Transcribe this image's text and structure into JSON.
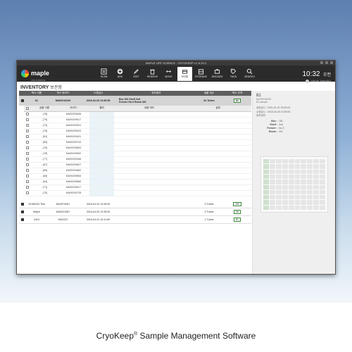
{
  "window": {
    "title": "MAPLE LIFE SCIENCE - CRYOKEEP v.1.6.20.2"
  },
  "brand": {
    "name": "maple",
    "tagline": "LIFE SCIENCE"
  },
  "toolbar": [
    {
      "label": "SCAN",
      "icon": "scan-icon"
    },
    {
      "label": "ADD",
      "icon": "add-icon"
    },
    {
      "label": "EDIT",
      "icon": "edit-icon"
    },
    {
      "label": "REMOVE",
      "icon": "remove-icon"
    },
    {
      "label": "MOVE",
      "icon": "move-icon"
    },
    {
      "label": "보관함",
      "icon": "storage-box-icon",
      "active": true
    },
    {
      "label": "STORAGE",
      "icon": "storage-icon"
    },
    {
      "label": "DISCARD",
      "icon": "discard-icon"
    },
    {
      "label": "TAGS",
      "icon": "tag-icon"
    },
    {
      "label": "SEARCH",
      "icon": "search-icon"
    }
  ],
  "clock": {
    "time": "10:32",
    "ampm": "오전",
    "user": "admin (Maple)"
  },
  "page": {
    "title": "INVENTORY",
    "subtitle": "보관함"
  },
  "top_table": {
    "headers": [
      "",
      "박스 이름",
      "박스 바코드",
      "스캔일시",
      "위치정보",
      "샘플 개수",
      "박스 규격"
    ],
    "row": {
      "name": "81",
      "barcode": "MU00016209",
      "datetime": "2018-04-25 13:35:55",
      "loc_line1": "Box 181      Shelf 2nd",
      "loc_line2": "Freezer No.3   Room 301",
      "count": "81 Tubes",
      "capacity": "81"
    }
  },
  "sub_table": {
    "headers": [
      "",
      "샘플 이름",
      "바코드",
      "웰위",
      "샘플 메모",
      "설명"
    ],
    "rows": [
      {
        "name": "- [78]",
        "barcode": "MU00209636"
      },
      {
        "name": "- [79]",
        "barcode": "MU00209617"
      },
      {
        "name": "- [74]",
        "barcode": "MU00209301"
      },
      {
        "name": "- [75]",
        "barcode": "MU00209619"
      },
      {
        "name": "- [81]",
        "barcode": "MU00209401"
      },
      {
        "name": "- [80]",
        "barcode": "MU00209743"
      },
      {
        "name": "- [76]",
        "barcode": "MU00209653"
      },
      {
        "name": "- [78]",
        "barcode": "MU00209692"
      },
      {
        "name": "- [77]",
        "barcode": "MU00209458"
      },
      {
        "name": "- [67]",
        "barcode": "MU00209607"
      },
      {
        "name": "- [66]",
        "barcode": "MU00209662"
      },
      {
        "name": "- [65]",
        "barcode": "MU00209564"
      },
      {
        "name": "- [64]",
        "barcode": "MU00209660"
      },
      {
        "name": "- [71]",
        "barcode": "MU00209617"
      },
      {
        "name": "- [70]",
        "barcode": "MU00209728"
      }
    ]
  },
  "bottom_table": {
    "rows": [
      {
        "name": "20180420 Test",
        "barcode": "MU4974061",
        "datetime": "2018-04-25 13:35:05",
        "count": "0 Tubes",
        "capacity": "100"
      },
      {
        "name": "Maple",
        "barcode": "MU0021567",
        "datetime": "2018-04-25 13:35:05",
        "count": "0 Tubes",
        "capacity": "96"
      },
      {
        "name": "0423",
        "barcode": "MU2222",
        "datetime": "2018-04-23 10:41:59",
        "count": "1 Tubes",
        "capacity": "81"
      }
    ]
  },
  "detail": {
    "title": "81",
    "id": "MU00016209",
    "sub": "81 sample",
    "line1": "생성일시 : 2001-01-01 00:00:00",
    "line2": "수정일시 : 2018-04-25 13:35:55",
    "line3": "위치정보",
    "loc": [
      {
        "k": "Box :",
        "v": "181"
      },
      {
        "k": "Shelf :",
        "v": "2nd"
      },
      {
        "k": "Freezer :",
        "v": "No.3"
      },
      {
        "k": "Room :",
        "v": "301"
      }
    ]
  },
  "caption": {
    "text": "CryoKeep",
    "reg": "®",
    "rest": " Sample Management Software"
  }
}
